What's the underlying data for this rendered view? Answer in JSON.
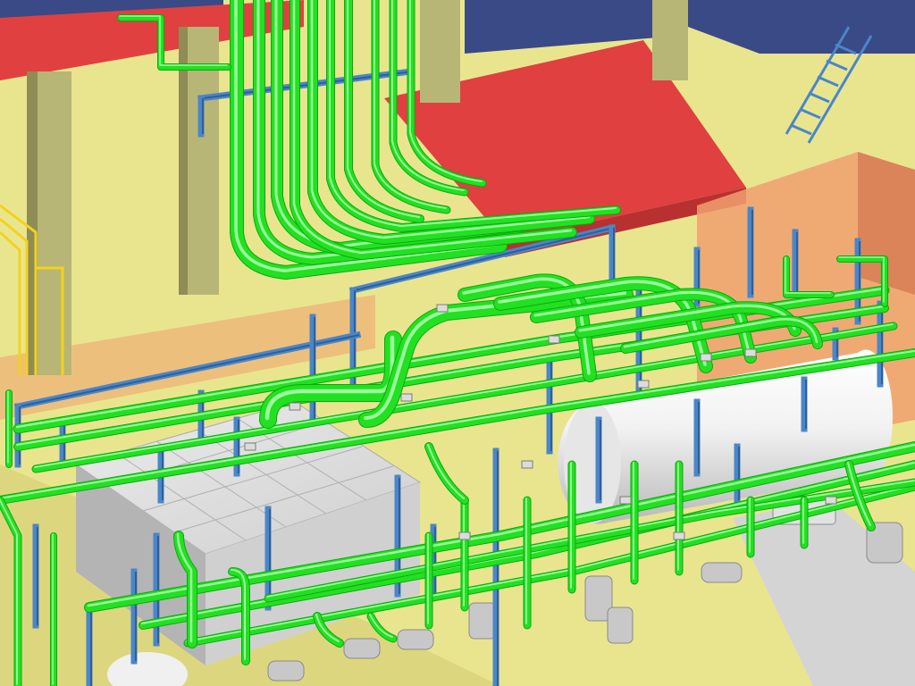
{
  "scene": {
    "colors": {
      "floor": "#e9e58f",
      "floor_shadow": "#d8d27a",
      "column": "#b8b676",
      "column_dark": "#8f8d55",
      "roof_red": "#e04040",
      "roof_red_dark": "#b83030",
      "navy_beam": "#3a4a86",
      "blue_steel": "#4a86c8",
      "blue_steel_dark": "#2f5f98",
      "pipe_green": "#22e022",
      "pipe_green_dark": "#0fa80f",
      "pipe_green_light": "#9cff9c",
      "wall_salmon": "#f0a070",
      "wall_salmon_dark": "#d88058",
      "equipment_gray": "#d4d4d4",
      "equipment_gray_dark": "#9c9c9c",
      "tank_white": "#f2f2f2",
      "tank_shade": "#c8c8c8",
      "yellow_pipe": "#f4d21c"
    }
  }
}
